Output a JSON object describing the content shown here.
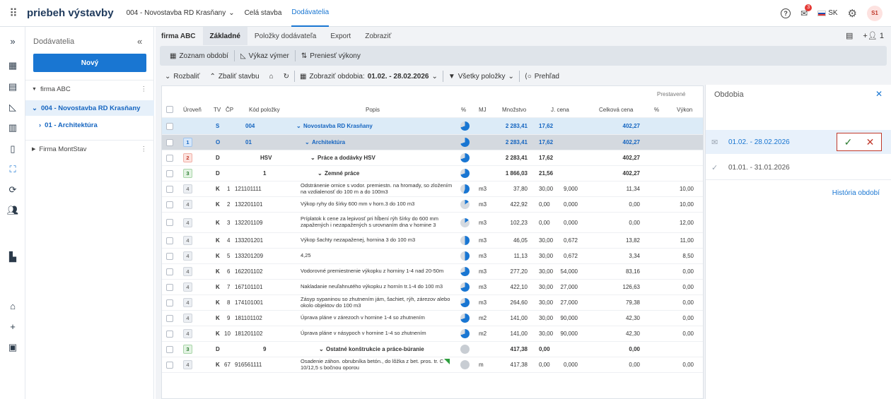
{
  "topbar": {
    "brand": "priebeh výstavby",
    "project": "004 - Novostavba RD Krasňany",
    "links": [
      "Celá stavba",
      "Dodávatelia"
    ],
    "notifications_count": "3",
    "language": "SK",
    "avatar_initials": "S1"
  },
  "rail": [
    "expand-icon",
    "dashboard-icon",
    "document-icon",
    "measure-icon",
    "chart-icon",
    "book-icon",
    "suppliers-icon",
    "sync-icon",
    "people-icon",
    "building-icon",
    "home-icon",
    "plus-icon",
    "report-icon"
  ],
  "sidepanel": {
    "title": "Dodávatelia",
    "new_button": "Nový",
    "tree": [
      {
        "label": "firma ABC"
      },
      {
        "label": "004 - Novostavba RD Krasňany"
      },
      {
        "label": "01 - Architektúra"
      },
      {
        "label": "Firma MontStav"
      }
    ]
  },
  "tabs": {
    "company": "firma ABC",
    "items": [
      "Základné",
      "Položky dodávateľa",
      "Export",
      "Zobraziť"
    ],
    "right_count": "1"
  },
  "toolbar1": [
    "Zoznam období",
    "Výkaz výmer",
    "Preniesť výkony"
  ],
  "toolbar2": {
    "expand": "Rozbaliť",
    "collapse": "Zbaliť stavbu",
    "periods_label": "Zobraziť obdobia:",
    "periods_value": "01.02. - 28.02.2026",
    "filter": "Všetky položky",
    "overview": "Prehľad"
  },
  "grid": {
    "group_header": "Prestavené",
    "headers": [
      "Úroveň",
      "TV",
      "ČP",
      "Kód položky",
      "Popis",
      "%",
      "MJ",
      "Množstvo",
      "J. cena",
      "Celková cena",
      "%",
      "Výkon"
    ],
    "rows": [
      {
        "lvl": "",
        "tv": "S",
        "cp": "",
        "kod": "004",
        "popis": "Novostavba RD Krasňany",
        "pie": 0.7,
        "mj": "",
        "mnoz": "2 283,41",
        "jc": "17,62",
        "jc2": "",
        "cc": "402,27",
        "pct": "",
        "vyk": "",
        "type": "project"
      },
      {
        "lvl": "1",
        "tv": "O",
        "cp": "",
        "kod": "01",
        "popis": "Architektúra",
        "pie": 0.7,
        "mj": "",
        "mnoz": "2 283,41",
        "jc": "17,62",
        "jc2": "",
        "cc": "402,27",
        "pct": "",
        "vyk": "",
        "type": "object"
      },
      {
        "lvl": "2",
        "tv": "D",
        "cp": "",
        "kod": "HSV",
        "popis": "Práce a dodávky HSV",
        "pie": 0.7,
        "mj": "",
        "mnoz": "2 283,41",
        "jc": "17,62",
        "jc2": "",
        "cc": "402,27",
        "pct": "",
        "vyk": "",
        "type": "group"
      },
      {
        "lvl": "3",
        "tv": "D",
        "cp": "",
        "kod": "1",
        "popis": "Zemné práce",
        "pie": 0.7,
        "mj": "",
        "mnoz": "1 866,03",
        "jc": "21,56",
        "jc2": "",
        "cc": "402,27",
        "pct": "",
        "vyk": "",
        "type": "group"
      },
      {
        "lvl": "4",
        "tv": "K",
        "cp": "1",
        "kod": "121101111",
        "popis": "Odstránenie ornice s vodor. premiestn. na hromady, so zložením na vzdialenosť do 100 m a do 100m3",
        "pie": 0.55,
        "mj": "m3",
        "mnoz": "37,80",
        "jc": "30,00",
        "jc2": "9,000",
        "cc": "11,34",
        "pct": "",
        "vyk": "10,00",
        "type": "item"
      },
      {
        "lvl": "4",
        "tv": "K",
        "cp": "2",
        "kod": "132201101",
        "popis": "Výkop ryhy do šírky 600 mm v horn.3 do 100 m3",
        "pie": 0.15,
        "mj": "m3",
        "mnoz": "422,92",
        "jc": "0,00",
        "jc2": "0,000",
        "cc": "0,00",
        "pct": "",
        "vyk": "10,00",
        "type": "item"
      },
      {
        "lvl": "4",
        "tv": "K",
        "cp": "3",
        "kod": "132201109",
        "popis": "Príplatok k cene za lepivosť pri hĺbení rýh šírky do 600 mm zapažených i nezapažených s urovnaním dna v hornine 3",
        "pie": 0.15,
        "mj": "m3",
        "mnoz": "102,23",
        "jc": "0,00",
        "jc2": "0,000",
        "cc": "0,00",
        "pct": "",
        "vyk": "12,00",
        "type": "item"
      },
      {
        "lvl": "4",
        "tv": "K",
        "cp": "4",
        "kod": "133201201",
        "popis": "Výkop šachty nezapaženej, hornina 3 do 100 m3",
        "pie": 0.5,
        "mj": "m3",
        "mnoz": "46,05",
        "jc": "30,00",
        "jc2": "0,672",
        "cc": "13,82",
        "pct": "",
        "vyk": "11,00",
        "type": "item"
      },
      {
        "lvl": "4",
        "tv": "K",
        "cp": "5",
        "kod": "133201209",
        "popis": "4,25",
        "pie": 0.5,
        "mj": "m3",
        "mnoz": "11,13",
        "jc": "30,00",
        "jc2": "0,672",
        "cc": "3,34",
        "pct": "",
        "vyk": "8,50",
        "type": "item"
      },
      {
        "lvl": "4",
        "tv": "K",
        "cp": "6",
        "kod": "162201102",
        "popis": "Vodorovné premiestnenie výkopku z horniny 1-4 nad 20-50m",
        "pie": 0.7,
        "mj": "m3",
        "mnoz": "277,20",
        "jc": "30,00",
        "jc2": "54,000",
        "cc": "83,16",
        "pct": "",
        "vyk": "0,00",
        "type": "item"
      },
      {
        "lvl": "4",
        "tv": "K",
        "cp": "7",
        "kod": "167101101",
        "popis": "Nakladanie neuľahnutého výkopku z hornín tr.1-4 do 100 m3",
        "pie": 0.7,
        "mj": "m3",
        "mnoz": "422,10",
        "jc": "30,00",
        "jc2": "27,000",
        "cc": "126,63",
        "pct": "",
        "vyk": "0,00",
        "type": "item"
      },
      {
        "lvl": "4",
        "tv": "K",
        "cp": "8",
        "kod": "174101001",
        "popis": "Zásyp sypaninou so zhutnením jám, šachiet, rýh, zárezov alebo okolo objektov do 100 m3",
        "pie": 0.7,
        "mj": "m3",
        "mnoz": "264,60",
        "jc": "30,00",
        "jc2": "27,000",
        "cc": "79,38",
        "pct": "",
        "vyk": "0,00",
        "type": "item"
      },
      {
        "lvl": "4",
        "tv": "K",
        "cp": "9",
        "kod": "181101102",
        "popis": "Úprava pláne v zárezoch v hornine 1-4 so zhutnením",
        "pie": 0.7,
        "mj": "m2",
        "mnoz": "141,00",
        "jc": "30,00",
        "jc2": "90,000",
        "cc": "42,30",
        "pct": "",
        "vyk": "0,00",
        "type": "item"
      },
      {
        "lvl": "4",
        "tv": "K",
        "cp": "10",
        "kod": "181201102",
        "popis": "Úprava pláne v násypoch v hornine 1-4 so zhutnením",
        "pie": 0.7,
        "mj": "m2",
        "mnoz": "141,00",
        "jc": "30,00",
        "jc2": "90,000",
        "cc": "42,30",
        "pct": "",
        "vyk": "0,00",
        "type": "item"
      },
      {
        "lvl": "3",
        "tv": "D",
        "cp": "",
        "kod": "9",
        "popis": "Ostatné konštrukcie a práce-búranie",
        "pie": 0,
        "mj": "",
        "mnoz": "417,38",
        "jc": "0,00",
        "jc2": "",
        "cc": "0,00",
        "pct": "",
        "vyk": "",
        "type": "group"
      },
      {
        "lvl": "4",
        "tv": "K",
        "cp": "67",
        "kod": "916561111",
        "popis": "Osadenie záhon. obrubníka betón., do lôžka z bet. pros. tr. C 10/12,5 s bočnou oporou",
        "pie": 0,
        "mj": "m",
        "mnoz": "417,38",
        "jc": "0,00",
        "jc2": "0,000",
        "cc": "0,00",
        "pct": "",
        "vyk": "0,00",
        "type": "item"
      }
    ]
  },
  "periods_panel": {
    "title": "Obdobia",
    "items": [
      "01.02. - 28.02.2026",
      "01.01. - 31.01.2026"
    ],
    "history_link": "História období"
  }
}
